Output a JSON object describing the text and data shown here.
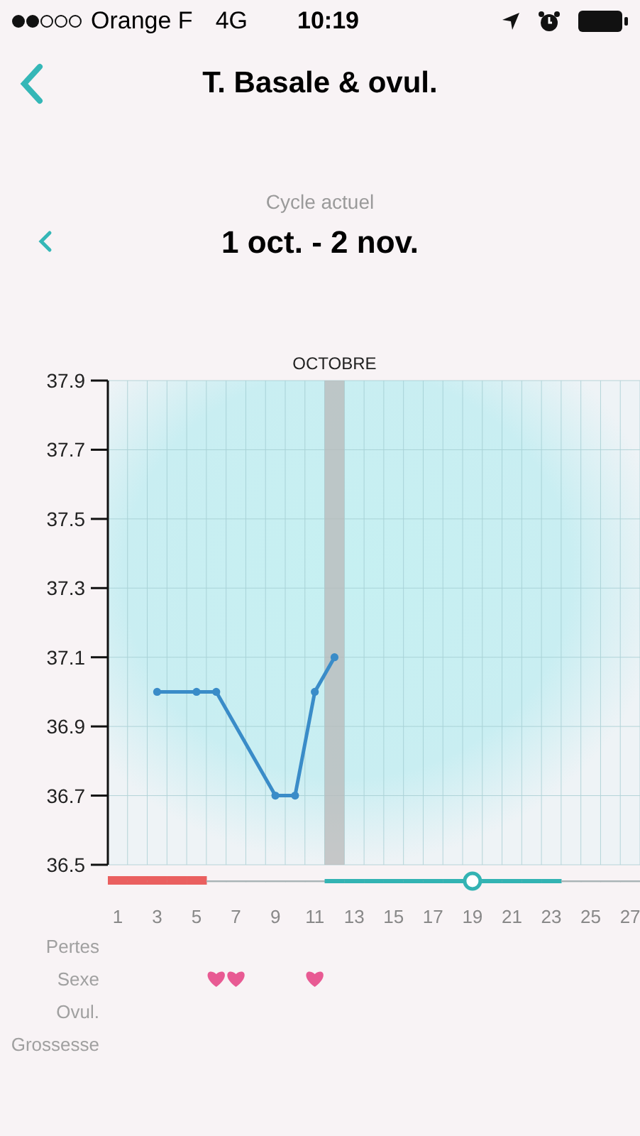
{
  "status_bar": {
    "carrier": "Orange F",
    "network": "4G",
    "time": "10:19"
  },
  "nav": {
    "title": "T. Basale & ovul."
  },
  "cycle": {
    "label": "Cycle actuel",
    "range": "1 oct. - 2 nov."
  },
  "chart": {
    "month_label": "OCTOBRE",
    "chart_data": {
      "type": "line",
      "x": [
        3,
        5,
        6,
        9,
        10,
        11,
        12
      ],
      "series": [
        {
          "color": "#3a8cc8",
          "marker": "o",
          "values": [
            37.0,
            37.0,
            37.0,
            36.7,
            36.7,
            37.0,
            37.1
          ]
        }
      ],
      "xlim": [
        0.5,
        27.5
      ],
      "ylim": [
        36.5,
        37.9
      ],
      "grid": true,
      "yticks": [
        36.5,
        36.7,
        36.9,
        37.1,
        37.3,
        37.5,
        37.7,
        37.9
      ],
      "xticks": [
        1,
        3,
        5,
        7,
        9,
        11,
        13,
        15,
        17,
        19,
        21,
        23,
        25,
        27
      ],
      "bands": [
        {
          "axis": "x",
          "from": 11.5,
          "to": 12.5,
          "color": "#b8b8b8"
        }
      ]
    },
    "days": [
      {
        "period": true,
        "fertile": false,
        "ovulation": false,
        "sex": false
      },
      {
        "period": true,
        "fertile": false,
        "ovulation": false,
        "sex": false
      },
      {
        "period": true,
        "fertile": false,
        "ovulation": false,
        "sex": false
      },
      {
        "period": true,
        "fertile": false,
        "ovulation": false,
        "sex": false
      },
      {
        "period": true,
        "fertile": false,
        "ovulation": false,
        "sex": false
      },
      {
        "period": false,
        "fertile": false,
        "ovulation": false,
        "sex": true
      },
      {
        "period": false,
        "fertile": false,
        "ovulation": false,
        "sex": true
      },
      {
        "period": false,
        "fertile": false,
        "ovulation": false,
        "sex": false
      },
      {
        "period": false,
        "fertile": false,
        "ovulation": false,
        "sex": false
      },
      {
        "period": false,
        "fertile": false,
        "ovulation": false,
        "sex": false
      },
      {
        "period": false,
        "fertile": false,
        "ovulation": false,
        "sex": true
      },
      {
        "period": false,
        "fertile": true,
        "ovulation": false,
        "sex": false
      },
      {
        "period": false,
        "fertile": true,
        "ovulation": false,
        "sex": false
      },
      {
        "period": false,
        "fertile": true,
        "ovulation": false,
        "sex": false
      },
      {
        "period": false,
        "fertile": true,
        "ovulation": false,
        "sex": false
      },
      {
        "period": false,
        "fertile": true,
        "ovulation": false,
        "sex": false
      },
      {
        "period": false,
        "fertile": true,
        "ovulation": false,
        "sex": false
      },
      {
        "period": false,
        "fertile": true,
        "ovulation": false,
        "sex": false
      },
      {
        "period": false,
        "fertile": true,
        "ovulation": true,
        "sex": false
      },
      {
        "period": false,
        "fertile": true,
        "ovulation": false,
        "sex": false
      },
      {
        "period": false,
        "fertile": true,
        "ovulation": false,
        "sex": false
      },
      {
        "period": false,
        "fertile": true,
        "ovulation": false,
        "sex": false
      },
      {
        "period": false,
        "fertile": true,
        "ovulation": false,
        "sex": false
      },
      {
        "period": false,
        "fertile": false,
        "ovulation": false,
        "sex": false
      },
      {
        "period": false,
        "fertile": false,
        "ovulation": false,
        "sex": false
      },
      {
        "period": false,
        "fertile": false,
        "ovulation": false,
        "sex": false
      },
      {
        "period": false,
        "fertile": false,
        "ovulation": false,
        "sex": false
      }
    ],
    "rows": [
      {
        "label": "Pertes"
      },
      {
        "label": "Sexe"
      },
      {
        "label": "Ovul."
      },
      {
        "label": "Grossesse"
      }
    ]
  }
}
